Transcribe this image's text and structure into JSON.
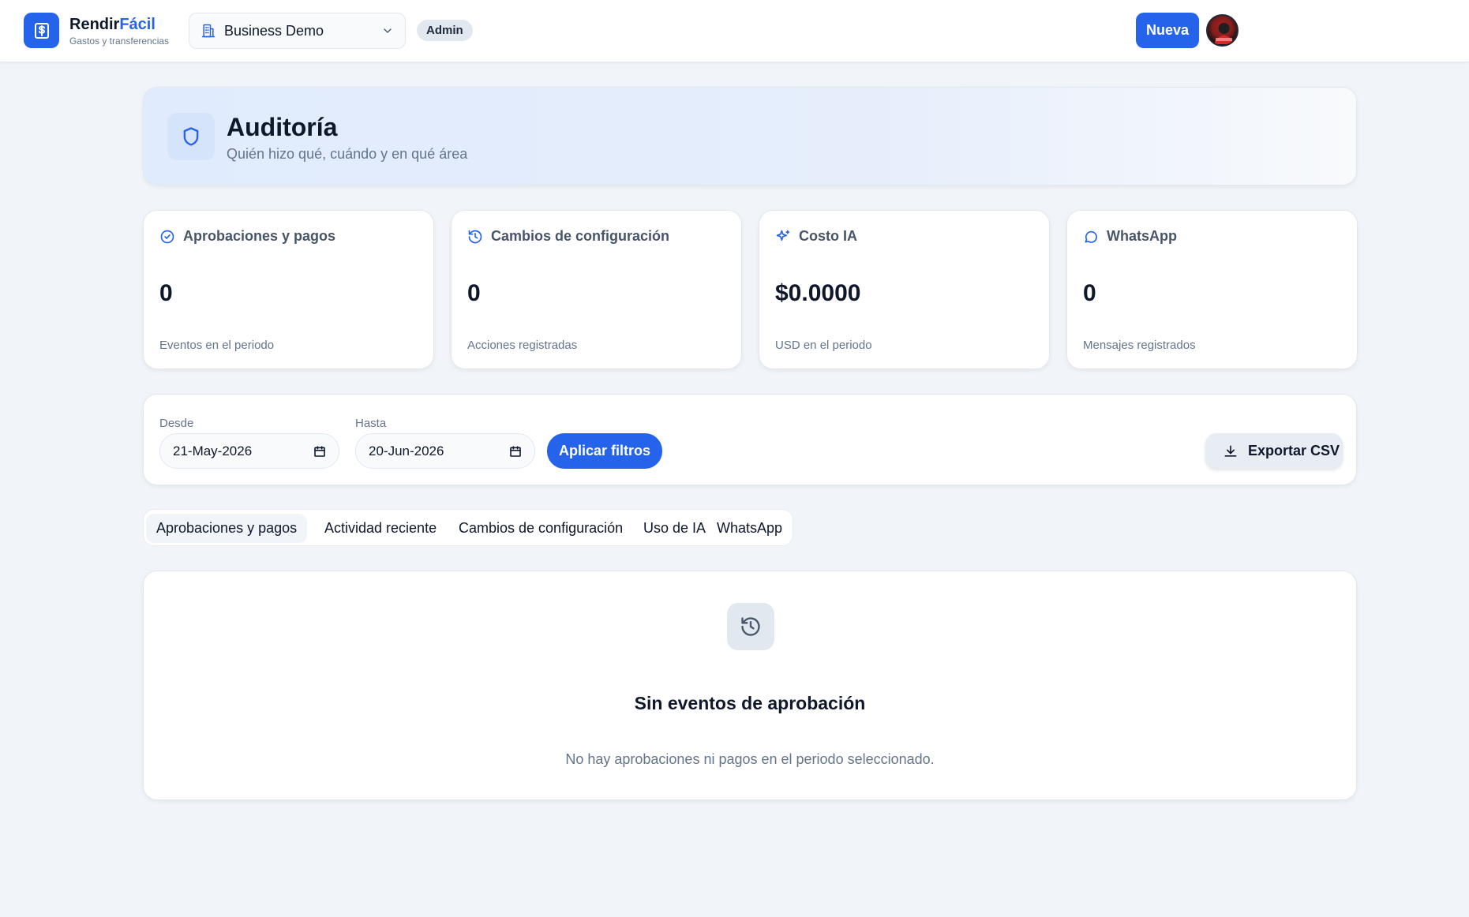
{
  "brand": {
    "name_part1": "Rendir",
    "name_part2": "Fácil",
    "subtitle": "Gastos y transferencias",
    "accent_color": "#2563eb"
  },
  "org_selector": {
    "value": "Business Demo"
  },
  "role_badge": "Admin",
  "header_actions": {
    "new_label": "Nueva"
  },
  "page": {
    "title": "Auditoría",
    "subtitle": "Quién hizo qué, cuándo y en qué área"
  },
  "stats": [
    {
      "title": "Aprobaciones y pagos",
      "value": "0",
      "caption": "Eventos en el periodo",
      "icon": "check-circle-icon"
    },
    {
      "title": "Cambios de configuración",
      "value": "0",
      "caption": "Acciones registradas",
      "icon": "history-icon"
    },
    {
      "title": "Costo IA",
      "value": "$0.0000",
      "caption": "USD en el periodo",
      "icon": "sparkles-icon"
    },
    {
      "title": "WhatsApp",
      "value": "0",
      "caption": "Mensajes registrados",
      "icon": "chat-bubble-icon"
    }
  ],
  "filters": {
    "from_label": "Desde",
    "from_value": "21-May-2026",
    "to_label": "Hasta",
    "to_value": "20-Jun-2026",
    "apply_label": "Aplicar filtros",
    "export_label": "Exportar CSV"
  },
  "tabs": [
    {
      "label": "Aprobaciones y pagos",
      "active": true
    },
    {
      "label": "Actividad reciente",
      "active": false
    },
    {
      "label": "Cambios de configuración",
      "active": false
    },
    {
      "label": "Uso de IA",
      "active": false
    },
    {
      "label": "WhatsApp",
      "active": false
    }
  ],
  "empty_state": {
    "title": "Sin eventos de aprobación",
    "message": "No hay aprobaciones ni pagos en el periodo seleccionado.",
    "icon": "history-icon"
  }
}
